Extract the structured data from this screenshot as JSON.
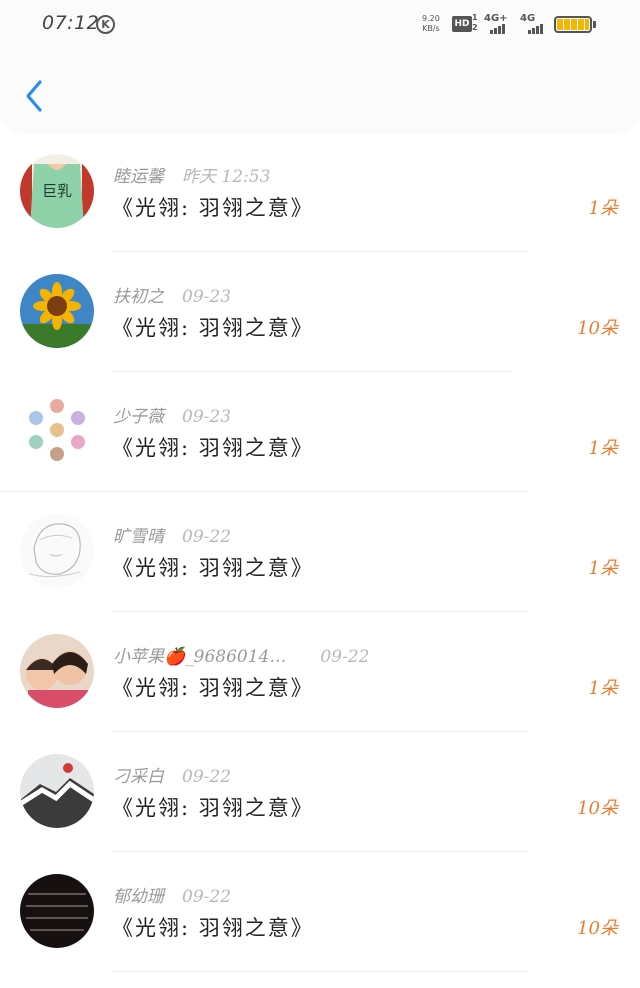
{
  "status_bar": {
    "time": "07:12",
    "k_badge": "K",
    "speed_value": "9.20",
    "speed_unit": "KB/s",
    "hd_label": "HD",
    "sim1_label": "4G+",
    "sim2_label": "4G",
    "battery_color": "#f4b400"
  },
  "colors": {
    "accent": "#2a8cf0",
    "count": "#f07b2e"
  },
  "rows": [
    {
      "name": "睦运馨",
      "date": "昨天 12:53",
      "title": "《光翎: 羽翎之意》",
      "count": "1朵"
    },
    {
      "name": "扶初之",
      "date": "09-23",
      "title": "《光翎: 羽翎之意》",
      "count": "10朵"
    },
    {
      "name": "少子薇",
      "date": "09-23",
      "title": "《光翎: 羽翎之意》",
      "count": "1朵"
    },
    {
      "name": "旷雪晴",
      "date": "09-22",
      "title": "《光翎: 羽翎之意》",
      "count": "1朵"
    },
    {
      "name": "小苹果🍎_9686014…",
      "date": "09-22",
      "title": "《光翎: 羽翎之意》",
      "count": "1朵"
    },
    {
      "name": "刁采白",
      "date": "09-22",
      "title": "《光翎: 羽翎之意》",
      "count": "10朵"
    },
    {
      "name": "郁幼珊",
      "date": "09-22",
      "title": "《光翎: 羽翎之意》",
      "count": "10朵"
    }
  ],
  "avatar_text": {
    "row0": "巨乳"
  }
}
